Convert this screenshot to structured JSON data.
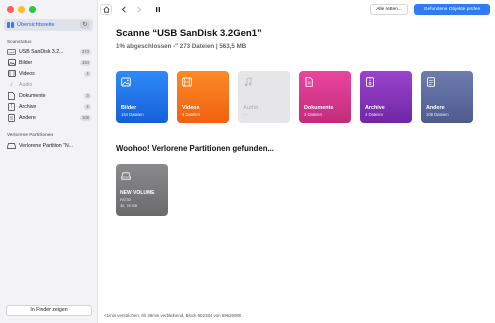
{
  "window": {
    "controls": [
      "close",
      "minimize",
      "zoom"
    ]
  },
  "sidebar": {
    "overview_label": "Übersichtsseite",
    "devices_title": "Scanstatus",
    "items": [
      {
        "label": "USB  SanDisk 3.2...",
        "count": "273",
        "icon": "usb-drive-icon"
      },
      {
        "label": "Bilder",
        "count": "154",
        "icon": "image-icon"
      },
      {
        "label": "Videos",
        "count": "4",
        "icon": "film-icon"
      },
      {
        "label": "Audio",
        "count": "",
        "icon": "music-note-icon"
      },
      {
        "label": "Dokumente",
        "count": "3",
        "icon": "document-icon"
      },
      {
        "label": "Archive",
        "count": "4",
        "icon": "archive-icon"
      },
      {
        "label": "Andere",
        "count": "108",
        "icon": "file-icon"
      }
    ],
    "partitions_title": "Verlorene Partitionen",
    "partition_item": "Verlorene Partition \"N...",
    "finder_button": "In Finder zeigen"
  },
  "toolbar": {
    "restore_button": "Alle retten...",
    "check_button": "Gefundene Objekte prüfen"
  },
  "main": {
    "title": "Scanne “USB  SanDisk 3.2Gen1”",
    "subtitle": "1% abgeschlossen -\" 273 Dateien | 563,5 MB",
    "cards": [
      {
        "name": "Bilder",
        "count": "154 Dateien",
        "icon": "image-icon"
      },
      {
        "name": "Videos",
        "count": "4 Dateien",
        "icon": "film-icon"
      },
      {
        "name": "Audio",
        "count": "—",
        "icon": "music-note-icon"
      },
      {
        "name": "Dokumente",
        "count": "3 Dateien",
        "icon": "document-icon"
      },
      {
        "name": "Archive",
        "count": "4 Dateien",
        "icon": "archive-icon"
      },
      {
        "name": "Andere",
        "count": "108 Dateien",
        "icon": "file-icon"
      }
    ],
    "partitions_heading": "Woohoo! Verlorene Partitionen gefunden...",
    "volume": {
      "name": "NEW VOLUME",
      "fs": "FAT32",
      "size": "30, 78 GB"
    }
  },
  "status_bar": "<1min verstrichen, 0h 38min verbleibend, Block 602184 von 59626080",
  "colors": {
    "accent": "#2f7bf6",
    "bilder": "#1f74ee",
    "videos": "#f5741a",
    "audio": "#e6e6e8",
    "dokumente": "#d83a8e",
    "archive": "#8436b9",
    "andere": "#5d6a9e",
    "volume": "#7a7a7c"
  }
}
